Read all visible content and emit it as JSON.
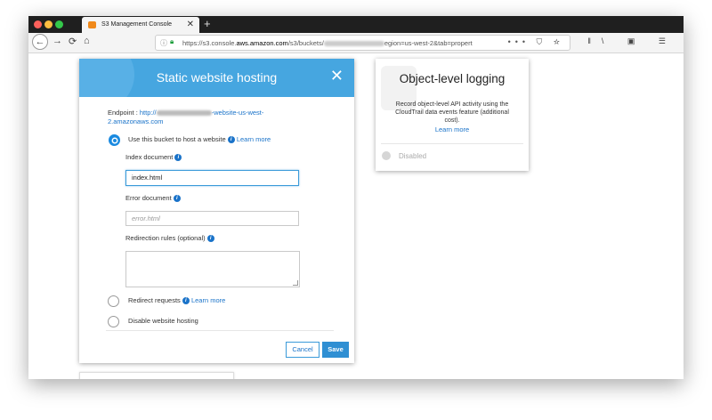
{
  "browser": {
    "tab_title": "S3 Management Console",
    "tab_close": "✕",
    "new_tab": "+",
    "url_prefix": "https://s3.console.",
    "url_domain": "aws.amazon.com",
    "url_path": "/s3/buckets/",
    "url_suffix": "egion=us-west-2&tab=propert",
    "url_actions": "••• ⛉ ☆",
    "right_icons": "ǁ\\ ▣ ☰"
  },
  "modal": {
    "title": "Static website hosting",
    "close_glyph": "✕",
    "endpoint_label": "Endpoint : ",
    "endpoint_prefix": "http://",
    "endpoint_suffix": "-website-us-west-2.amazonaws.com",
    "options": [
      {
        "label": "Use this bucket to host a website",
        "learn_more": "Learn more",
        "selected": true
      },
      {
        "label": "Redirect requests",
        "learn_more": "Learn more",
        "selected": false
      },
      {
        "label": "Disable website hosting",
        "selected": false
      }
    ],
    "index_document": {
      "label": "Index document",
      "value": "index.html"
    },
    "error_document": {
      "label": "Error document",
      "placeholder": "error.html"
    },
    "redirection_rules": {
      "label": "Redirection rules (optional)"
    },
    "cancel_label": "Cancel",
    "save_label": "Save",
    "info_glyph": "i"
  },
  "logging_card": {
    "title": "Object-level logging",
    "description": "Record object-level API activity using the CloudTrail data events feature (additional cost).",
    "learn_more": "Learn more",
    "status": "Disabled"
  },
  "colors": {
    "header_blue": "#46a6e0",
    "link_blue": "#1a73c9",
    "save_blue": "#2f8fd3",
    "tab_favicon": "#f0891a"
  }
}
